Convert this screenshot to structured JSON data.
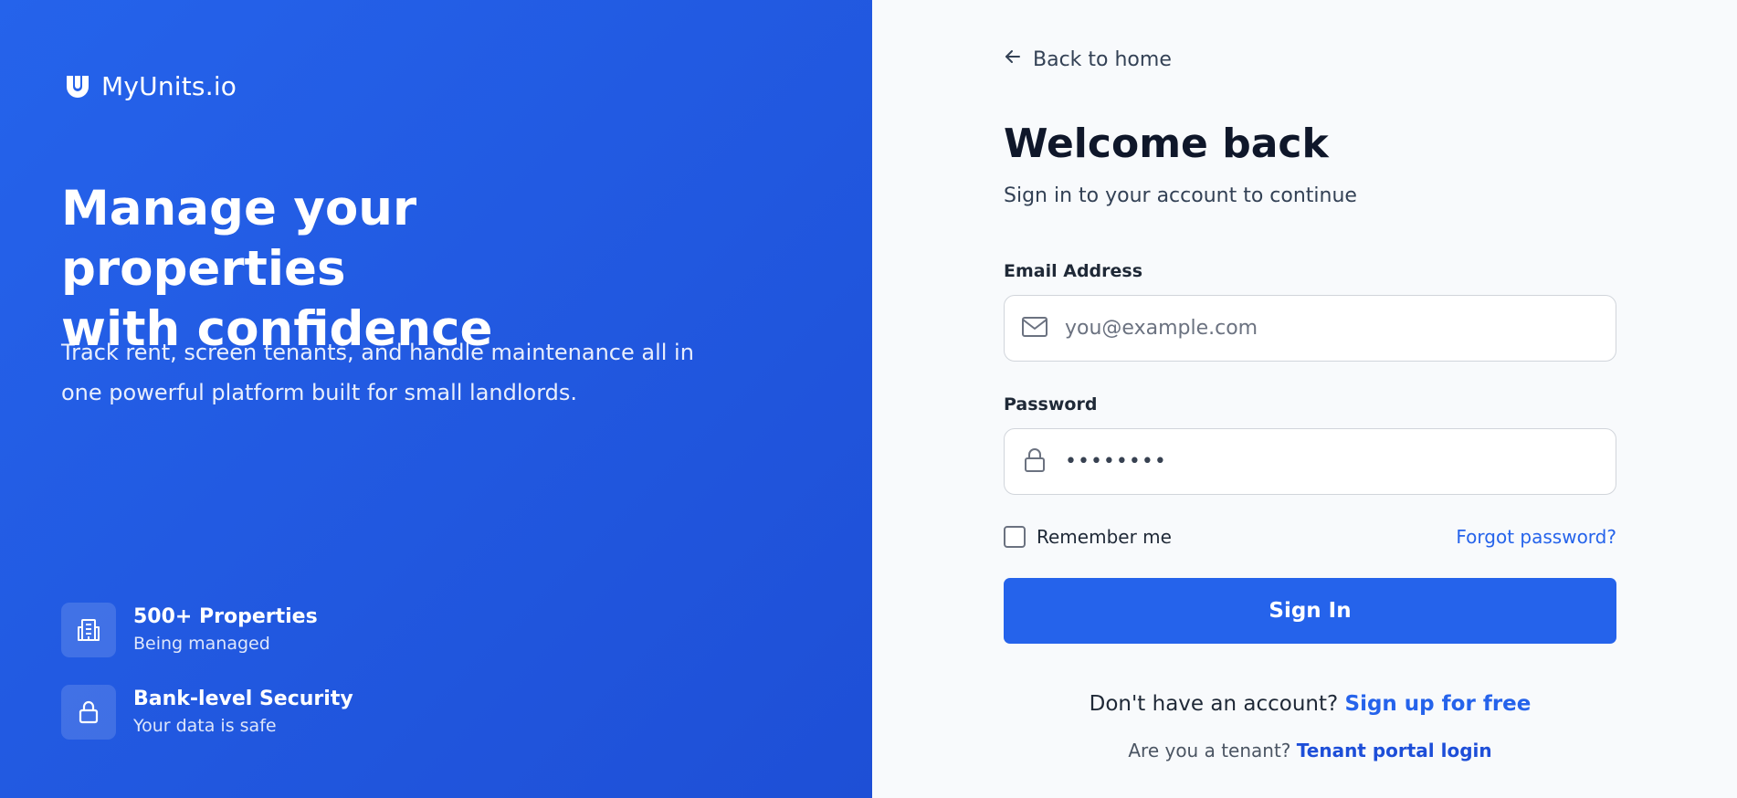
{
  "brand": {
    "name": "MyUnits.io",
    "logo_icon": "horseshoe-magnet-logo"
  },
  "hero": {
    "title_line1": "Manage your properties",
    "title_line2": "with confidence",
    "subtitle_line1": "Track rent, screen tenants, and handle maintenance all in",
    "subtitle_line2": "one powerful platform built for small landlords."
  },
  "features": [
    {
      "icon": "building-icon",
      "title": "500+ Properties",
      "subtitle": "Being managed"
    },
    {
      "icon": "lock-icon",
      "title": "Bank-level Security",
      "subtitle": "Your data is safe"
    }
  ],
  "auth": {
    "back_label": "Back to home",
    "title": "Welcome back",
    "subtitle": "Sign in to your account to continue",
    "email_label": "Email Address",
    "email_placeholder": "you@example.com",
    "email_value": "",
    "password_label": "Password",
    "password_value": "••••••••",
    "remember_label": "Remember me",
    "remember_checked": false,
    "forgot_label": "Forgot password?",
    "signin_label": "Sign In",
    "signup_prompt": "Don't have an account?",
    "signup_link": "Sign up for free",
    "tenant_prompt": "Are you a tenant?",
    "tenant_link": "Tenant portal login"
  },
  "colors": {
    "brand_blue": "#2563eb",
    "panel_gradient_end": "#1e4fd6",
    "right_background": "#f8fafc"
  }
}
